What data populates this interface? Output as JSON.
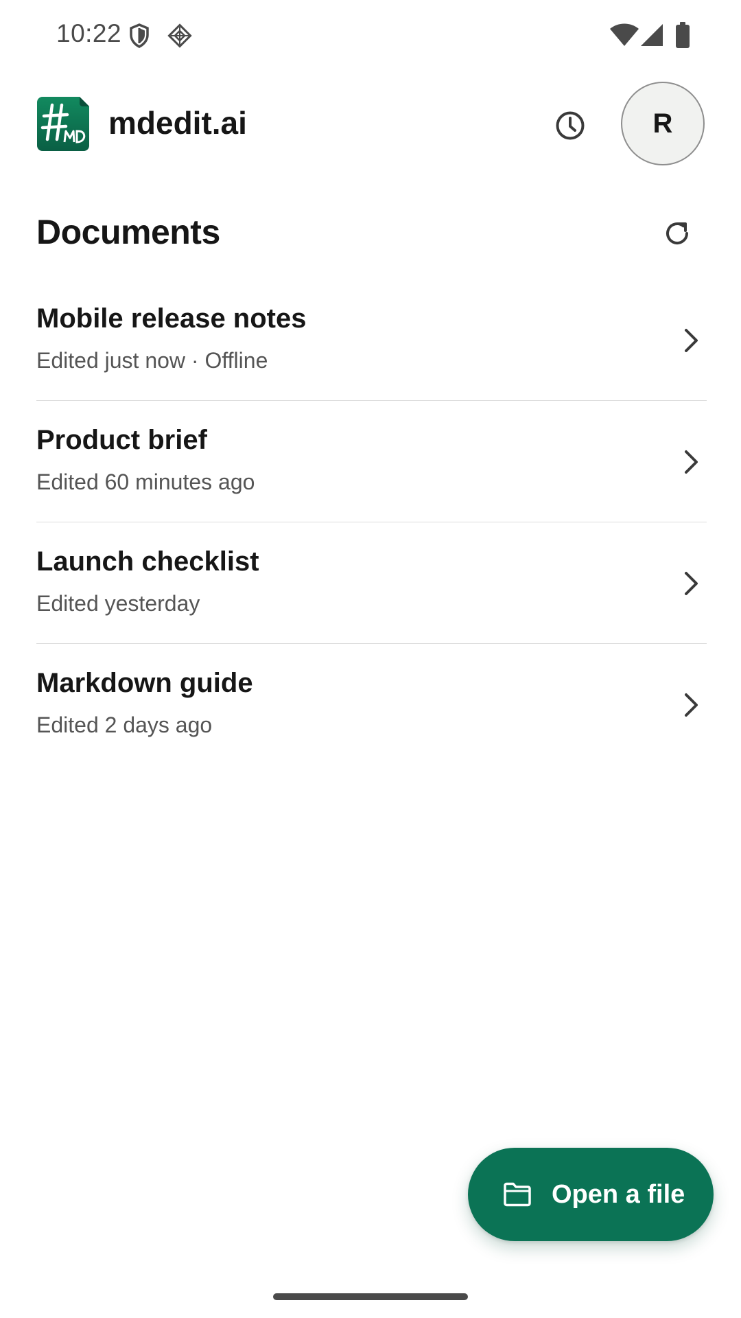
{
  "status_bar": {
    "time": "10:22",
    "icons": [
      "shield-icon",
      "vpn-diamond-icon",
      "wifi-icon",
      "cellular-signal-icon",
      "battery-icon"
    ]
  },
  "header": {
    "app_name": "mdedit.ai",
    "logo_text": "#MD",
    "avatar_initial": "R",
    "history_icon": "clock-icon"
  },
  "documents": {
    "title": "Documents",
    "refresh_icon": "refresh-icon",
    "items": [
      {
        "title": "Mobile release notes",
        "meta": "Edited just now · Offline"
      },
      {
        "title": "Product brief",
        "meta": "Edited 60 minutes ago"
      },
      {
        "title": "Launch checklist",
        "meta": "Edited yesterday"
      },
      {
        "title": "Markdown guide",
        "meta": "Edited 2 days ago"
      }
    ]
  },
  "fab": {
    "label": "Open a file",
    "icon": "folder-icon"
  },
  "colors": {
    "accent": "#0b7355",
    "logo_bg": "#0c6e4e",
    "text_primary": "#161616",
    "text_secondary": "#555555",
    "divider": "#dcdcdc",
    "avatar_bg": "#f1f2f0"
  }
}
